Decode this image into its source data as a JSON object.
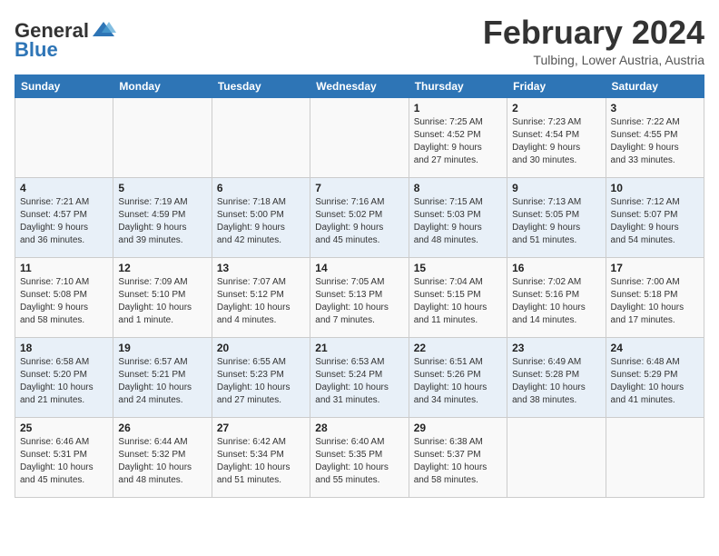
{
  "logo": {
    "text_general": "General",
    "text_blue": "Blue"
  },
  "header": {
    "month_year": "February 2024",
    "location": "Tulbing, Lower Austria, Austria"
  },
  "days_of_week": [
    "Sunday",
    "Monday",
    "Tuesday",
    "Wednesday",
    "Thursday",
    "Friday",
    "Saturday"
  ],
  "weeks": [
    [
      {
        "day": "",
        "info": ""
      },
      {
        "day": "",
        "info": ""
      },
      {
        "day": "",
        "info": ""
      },
      {
        "day": "",
        "info": ""
      },
      {
        "day": "1",
        "info": "Sunrise: 7:25 AM\nSunset: 4:52 PM\nDaylight: 9 hours\nand 27 minutes."
      },
      {
        "day": "2",
        "info": "Sunrise: 7:23 AM\nSunset: 4:54 PM\nDaylight: 9 hours\nand 30 minutes."
      },
      {
        "day": "3",
        "info": "Sunrise: 7:22 AM\nSunset: 4:55 PM\nDaylight: 9 hours\nand 33 minutes."
      }
    ],
    [
      {
        "day": "4",
        "info": "Sunrise: 7:21 AM\nSunset: 4:57 PM\nDaylight: 9 hours\nand 36 minutes."
      },
      {
        "day": "5",
        "info": "Sunrise: 7:19 AM\nSunset: 4:59 PM\nDaylight: 9 hours\nand 39 minutes."
      },
      {
        "day": "6",
        "info": "Sunrise: 7:18 AM\nSunset: 5:00 PM\nDaylight: 9 hours\nand 42 minutes."
      },
      {
        "day": "7",
        "info": "Sunrise: 7:16 AM\nSunset: 5:02 PM\nDaylight: 9 hours\nand 45 minutes."
      },
      {
        "day": "8",
        "info": "Sunrise: 7:15 AM\nSunset: 5:03 PM\nDaylight: 9 hours\nand 48 minutes."
      },
      {
        "day": "9",
        "info": "Sunrise: 7:13 AM\nSunset: 5:05 PM\nDaylight: 9 hours\nand 51 minutes."
      },
      {
        "day": "10",
        "info": "Sunrise: 7:12 AM\nSunset: 5:07 PM\nDaylight: 9 hours\nand 54 minutes."
      }
    ],
    [
      {
        "day": "11",
        "info": "Sunrise: 7:10 AM\nSunset: 5:08 PM\nDaylight: 9 hours\nand 58 minutes."
      },
      {
        "day": "12",
        "info": "Sunrise: 7:09 AM\nSunset: 5:10 PM\nDaylight: 10 hours\nand 1 minute."
      },
      {
        "day": "13",
        "info": "Sunrise: 7:07 AM\nSunset: 5:12 PM\nDaylight: 10 hours\nand 4 minutes."
      },
      {
        "day": "14",
        "info": "Sunrise: 7:05 AM\nSunset: 5:13 PM\nDaylight: 10 hours\nand 7 minutes."
      },
      {
        "day": "15",
        "info": "Sunrise: 7:04 AM\nSunset: 5:15 PM\nDaylight: 10 hours\nand 11 minutes."
      },
      {
        "day": "16",
        "info": "Sunrise: 7:02 AM\nSunset: 5:16 PM\nDaylight: 10 hours\nand 14 minutes."
      },
      {
        "day": "17",
        "info": "Sunrise: 7:00 AM\nSunset: 5:18 PM\nDaylight: 10 hours\nand 17 minutes."
      }
    ],
    [
      {
        "day": "18",
        "info": "Sunrise: 6:58 AM\nSunset: 5:20 PM\nDaylight: 10 hours\nand 21 minutes."
      },
      {
        "day": "19",
        "info": "Sunrise: 6:57 AM\nSunset: 5:21 PM\nDaylight: 10 hours\nand 24 minutes."
      },
      {
        "day": "20",
        "info": "Sunrise: 6:55 AM\nSunset: 5:23 PM\nDaylight: 10 hours\nand 27 minutes."
      },
      {
        "day": "21",
        "info": "Sunrise: 6:53 AM\nSunset: 5:24 PM\nDaylight: 10 hours\nand 31 minutes."
      },
      {
        "day": "22",
        "info": "Sunrise: 6:51 AM\nSunset: 5:26 PM\nDaylight: 10 hours\nand 34 minutes."
      },
      {
        "day": "23",
        "info": "Sunrise: 6:49 AM\nSunset: 5:28 PM\nDaylight: 10 hours\nand 38 minutes."
      },
      {
        "day": "24",
        "info": "Sunrise: 6:48 AM\nSunset: 5:29 PM\nDaylight: 10 hours\nand 41 minutes."
      }
    ],
    [
      {
        "day": "25",
        "info": "Sunrise: 6:46 AM\nSunset: 5:31 PM\nDaylight: 10 hours\nand 45 minutes."
      },
      {
        "day": "26",
        "info": "Sunrise: 6:44 AM\nSunset: 5:32 PM\nDaylight: 10 hours\nand 48 minutes."
      },
      {
        "day": "27",
        "info": "Sunrise: 6:42 AM\nSunset: 5:34 PM\nDaylight: 10 hours\nand 51 minutes."
      },
      {
        "day": "28",
        "info": "Sunrise: 6:40 AM\nSunset: 5:35 PM\nDaylight: 10 hours\nand 55 minutes."
      },
      {
        "day": "29",
        "info": "Sunrise: 6:38 AM\nSunset: 5:37 PM\nDaylight: 10 hours\nand 58 minutes."
      },
      {
        "day": "",
        "info": ""
      },
      {
        "day": "",
        "info": ""
      }
    ]
  ]
}
